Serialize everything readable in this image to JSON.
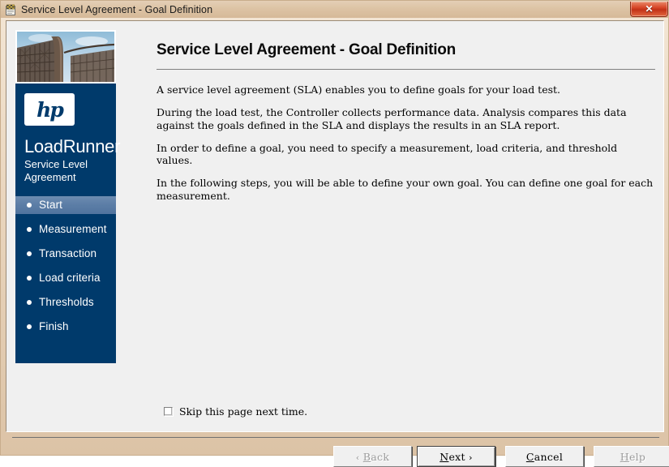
{
  "window": {
    "title": "Service Level Agreement - Goal Definition",
    "icon": "sla-wizard-icon",
    "close_label": "✕"
  },
  "sidebar": {
    "photo": "rollercoaster-photo",
    "logo_text": "hp",
    "product_name": "LoadRunner",
    "subtitle": "Service Level\nAgreement",
    "items": [
      {
        "label": "Start",
        "active": true
      },
      {
        "label": "Measurement",
        "active": false
      },
      {
        "label": "Transaction",
        "active": false
      },
      {
        "label": "Load criteria",
        "active": false
      },
      {
        "label": "Thresholds",
        "active": false
      },
      {
        "label": "Finish",
        "active": false
      }
    ]
  },
  "content": {
    "page_title": "Service Level Agreement - Goal Definition",
    "paragraphs": [
      "A service level agreement (SLA) enables you to define goals for your load test.",
      "During the load test, the Controller collects performance data. Analysis compares this data against the goals defined in the SLA and displays the results in an SLA report.",
      "In order to define a goal, you need to specify a measurement, load criteria, and threshold values.",
      "In the following steps, you will be able to define your own goal. You can define one goal for each measurement."
    ]
  },
  "skip": {
    "label": "Skip this page next time.",
    "checked": false
  },
  "buttons": {
    "back": {
      "prefix": "‹",
      "accel": "B",
      "rest": "ack",
      "disabled": true
    },
    "next": {
      "accel": "N",
      "rest": "ext",
      "suffix": "›",
      "default": true,
      "disabled": false
    },
    "cancel": {
      "accel": "C",
      "rest": "ancel",
      "disabled": false
    },
    "help": {
      "accel": "H",
      "rest": "elp",
      "disabled": true
    }
  },
  "colors": {
    "titlebar": "#dcc2a3",
    "sidebar": "#003a6b",
    "nav_active": "#5b7da6",
    "close_button": "#c23217",
    "client_bg": "#f0f0f0"
  }
}
